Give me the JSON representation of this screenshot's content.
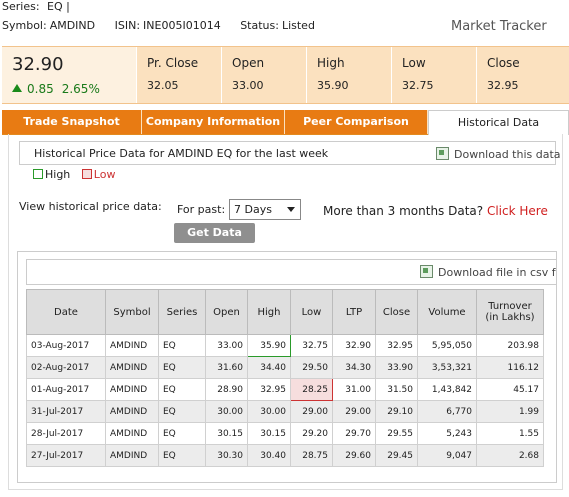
{
  "header": {
    "series_label": "Series:",
    "series_value": "EQ |",
    "symbol_label": "Symbol:",
    "symbol_value": "AMDIND",
    "isin_label": "ISIN:",
    "isin_value": "INE005I01014",
    "status_label": "Status:",
    "status_value": "Listed",
    "market_tracker": "Market Tracker"
  },
  "price": {
    "ltp": "32.90",
    "change": "0.85",
    "change_pct": "2.65%",
    "cells": [
      {
        "label": "Pr. Close",
        "value": "32.05"
      },
      {
        "label": "Open",
        "value": "33.00"
      },
      {
        "label": "High",
        "value": "35.90"
      },
      {
        "label": "Low",
        "value": "32.75"
      },
      {
        "label": "Close",
        "value": "32.95"
      }
    ]
  },
  "tabs": [
    {
      "label": "Trade Snapshot"
    },
    {
      "label": "Company Information"
    },
    {
      "label": "Peer Comparison"
    },
    {
      "label": "Historical Data"
    }
  ],
  "historical": {
    "title": "Historical Price Data for AMDIND EQ for the last week",
    "download_label": "Download this data",
    "legend_high": "High",
    "legend_low": "Low",
    "view_label": "View historical price data:",
    "for_past_label": "For past:",
    "selected_period": "7 Days",
    "more_text": "More than 3 months Data?",
    "click_here": "Click Here",
    "get_data_label": "Get Data",
    "csv_label": "Download file in csv format"
  },
  "table": {
    "headers": [
      "Date",
      "Symbol",
      "Series",
      "Open",
      "High",
      "Low",
      "LTP",
      "Close",
      "Volume",
      "Turnover\n(in Lakhs)"
    ],
    "rows": [
      [
        "03-Aug-2017",
        "AMDIND",
        "EQ",
        "33.00",
        "35.90",
        "32.75",
        "32.90",
        "32.95",
        "5,95,050",
        "203.98"
      ],
      [
        "02-Aug-2017",
        "AMDIND",
        "EQ",
        "31.60",
        "34.40",
        "29.50",
        "34.30",
        "33.90",
        "3,53,321",
        "116.12"
      ],
      [
        "01-Aug-2017",
        "AMDIND",
        "EQ",
        "28.90",
        "32.95",
        "28.25",
        "31.00",
        "31.50",
        "1,43,842",
        "45.17"
      ],
      [
        "31-Jul-2017",
        "AMDIND",
        "EQ",
        "30.00",
        "30.00",
        "29.00",
        "29.00",
        "29.10",
        "6,770",
        "1.99"
      ],
      [
        "28-Jul-2017",
        "AMDIND",
        "EQ",
        "30.15",
        "30.15",
        "29.20",
        "29.70",
        "29.55",
        "5,243",
        "1.55"
      ],
      [
        "27-Jul-2017",
        "AMDIND",
        "EQ",
        "30.30",
        "30.40",
        "28.75",
        "29.60",
        "29.45",
        "9,047",
        "2.68"
      ]
    ]
  },
  "colors": {
    "tab_orange": "#e87b13",
    "price_bar": "#fbe1bf",
    "high_green": "#2a9a2a",
    "low_red": "#cc3333",
    "click_red": "#d01f1f"
  }
}
